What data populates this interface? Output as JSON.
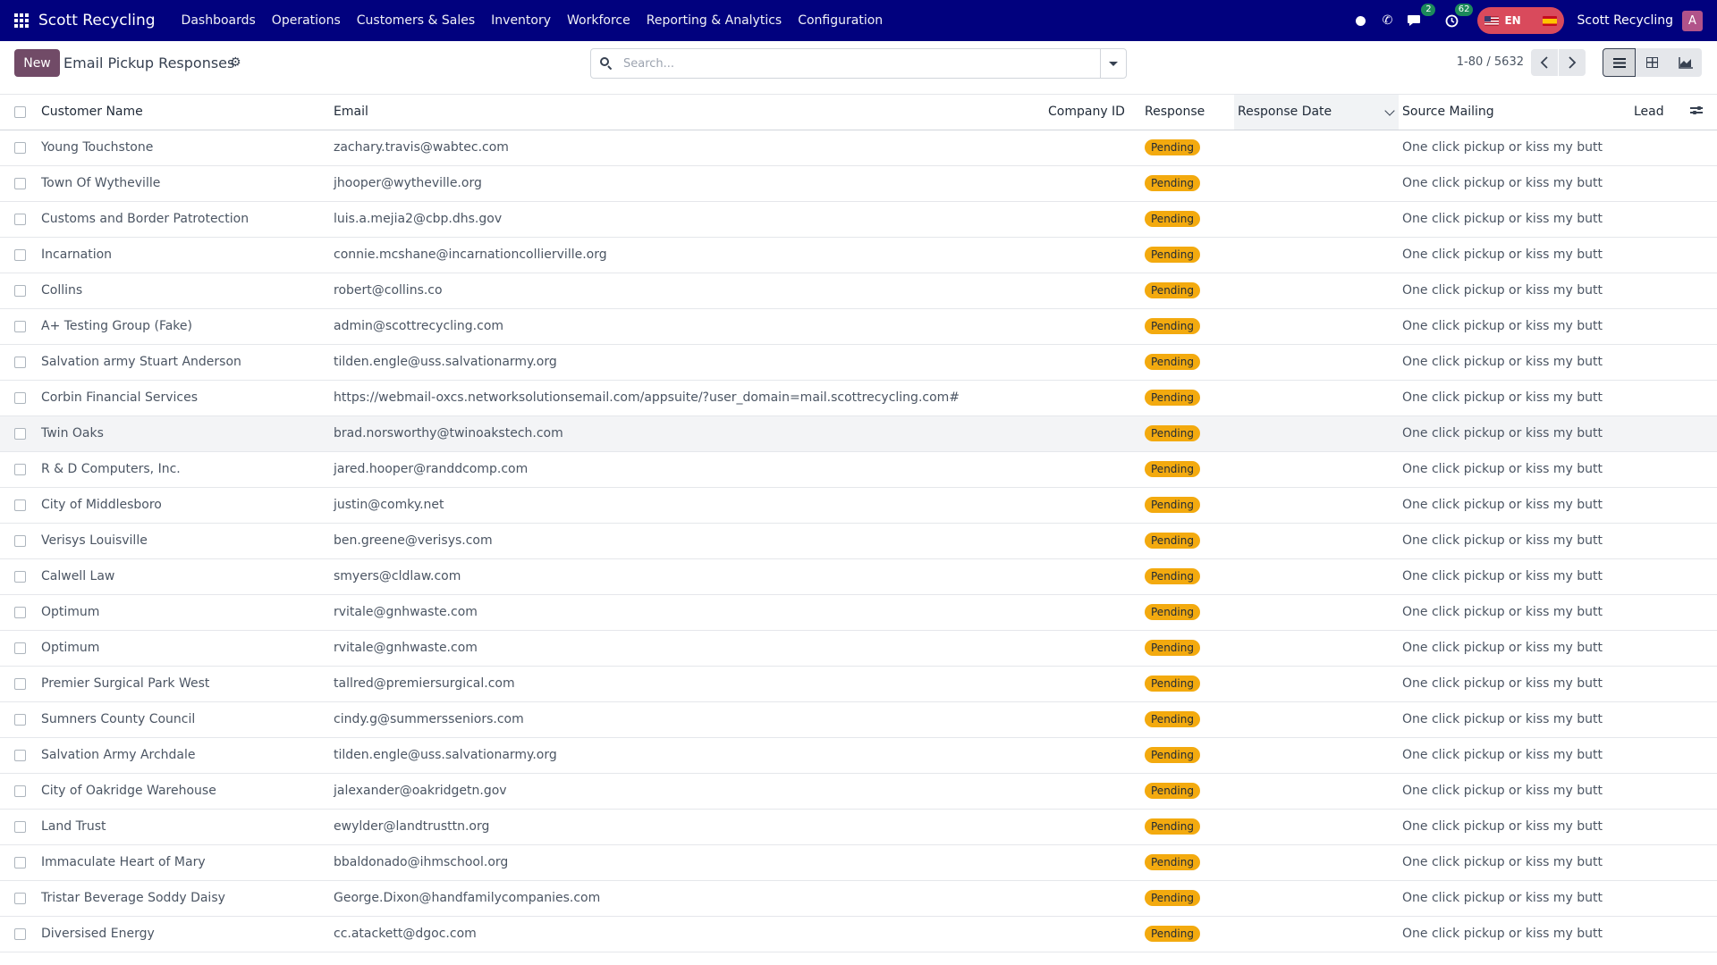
{
  "navbar": {
    "brand": "Scott Recycling",
    "menu": [
      "Dashboards",
      "Operations",
      "Customers & Sales",
      "Inventory",
      "Workforce",
      "Reporting & Analytics",
      "Configuration"
    ],
    "messages_badge": "2",
    "activities_badge": "62",
    "language": "EN",
    "company": "Scott Recycling",
    "avatar_letter": "A",
    "icons": [
      "apps-grid-icon",
      "status-dot-icon",
      "phone-icon",
      "chat-icon",
      "clock-icon",
      "flag-us-icon",
      "flag-es-icon"
    ]
  },
  "control": {
    "new_label": "New",
    "title": "Email Pickup Responses",
    "search_placeholder": "Search...",
    "pager": "1-80 / 5632"
  },
  "table": {
    "columns": {
      "customer": "Customer Name",
      "email": "Email",
      "company": "Company ID",
      "response": "Response",
      "date": "Response Date",
      "source": "Source Mailing",
      "lead": "Lead"
    },
    "rows": [
      {
        "customer": "Young Touchstone",
        "email": "zachary.travis@wabtec.com",
        "company": "",
        "response": "Pending",
        "date": "",
        "source": "One click pickup or kiss my butt",
        "lead": ""
      },
      {
        "customer": "Town Of Wytheville",
        "email": "jhooper@wytheville.org",
        "company": "",
        "response": "Pending",
        "date": "",
        "source": "One click pickup or kiss my butt",
        "lead": ""
      },
      {
        "customer": "Customs and Border Patrotection",
        "email": "luis.a.mejia2@cbp.dhs.gov",
        "company": "",
        "response": "Pending",
        "date": "",
        "source": "One click pickup or kiss my butt",
        "lead": ""
      },
      {
        "customer": "Incarnation",
        "email": "connie.mcshane@incarnationcollierville.org",
        "company": "",
        "response": "Pending",
        "date": "",
        "source": "One click pickup or kiss my butt",
        "lead": ""
      },
      {
        "customer": "Collins",
        "email": "robert@collins.co",
        "company": "",
        "response": "Pending",
        "date": "",
        "source": "One click pickup or kiss my butt",
        "lead": ""
      },
      {
        "customer": "A+ Testing Group (Fake)",
        "email": "admin@scottrecycling.com",
        "company": "",
        "response": "Pending",
        "date": "",
        "source": "One click pickup or kiss my butt",
        "lead": ""
      },
      {
        "customer": "Salvation army Stuart Anderson",
        "email": "tilden.engle@uss.salvationarmy.org",
        "company": "",
        "response": "Pending",
        "date": "",
        "source": "One click pickup or kiss my butt",
        "lead": ""
      },
      {
        "customer": "Corbin Financial Services",
        "email": "https://webmail-oxcs.networksolutionsemail.com/appsuite/?user_domain=mail.scottrecycling.com#",
        "company": "",
        "response": "Pending",
        "date": "",
        "source": "One click pickup or kiss my butt",
        "lead": ""
      },
      {
        "customer": "Twin Oaks",
        "email": "brad.norsworthy@twinoakstech.com",
        "company": "",
        "response": "Pending",
        "date": "",
        "source": "One click pickup or kiss my butt",
        "lead": ""
      },
      {
        "customer": "R & D Computers, Inc.",
        "email": "jared.hooper@randdcomp.com",
        "company": "",
        "response": "Pending",
        "date": "",
        "source": "One click pickup or kiss my butt",
        "lead": ""
      },
      {
        "customer": "City of Middlesboro",
        "email": "justin@comky.net",
        "company": "",
        "response": "Pending",
        "date": "",
        "source": "One click pickup or kiss my butt",
        "lead": ""
      },
      {
        "customer": "Verisys Louisville",
        "email": "ben.greene@verisys.com",
        "company": "",
        "response": "Pending",
        "date": "",
        "source": "One click pickup or kiss my butt",
        "lead": ""
      },
      {
        "customer": "Calwell Law",
        "email": "smyers@cldlaw.com",
        "company": "",
        "response": "Pending",
        "date": "",
        "source": "One click pickup or kiss my butt",
        "lead": ""
      },
      {
        "customer": "Optimum",
        "email": "rvitale@gnhwaste.com",
        "company": "",
        "response": "Pending",
        "date": "",
        "source": "One click pickup or kiss my butt",
        "lead": ""
      },
      {
        "customer": "Optimum",
        "email": "rvitale@gnhwaste.com",
        "company": "",
        "response": "Pending",
        "date": "",
        "source": "One click pickup or kiss my butt",
        "lead": ""
      },
      {
        "customer": "Premier Surgical Park West",
        "email": "tallred@premiersurgical.com",
        "company": "",
        "response": "Pending",
        "date": "",
        "source": "One click pickup or kiss my butt",
        "lead": ""
      },
      {
        "customer": "Sumners County Council",
        "email": "cindy.g@summersseniors.com",
        "company": "",
        "response": "Pending",
        "date": "",
        "source": "One click pickup or kiss my butt",
        "lead": ""
      },
      {
        "customer": "Salvation Army Archdale",
        "email": "tilden.engle@uss.salvationarmy.org",
        "company": "",
        "response": "Pending",
        "date": "",
        "source": "One click pickup or kiss my butt",
        "lead": ""
      },
      {
        "customer": "City of Oakridge Warehouse",
        "email": "jalexander@oakridgetn.gov",
        "company": "",
        "response": "Pending",
        "date": "",
        "source": "One click pickup or kiss my butt",
        "lead": ""
      },
      {
        "customer": "Land Trust",
        "email": "ewylder@landtrusttn.org",
        "company": "",
        "response": "Pending",
        "date": "",
        "source": "One click pickup or kiss my butt",
        "lead": ""
      },
      {
        "customer": "Immaculate Heart of Mary",
        "email": "bbaldonado@ihmschool.org",
        "company": "",
        "response": "Pending",
        "date": "",
        "source": "One click pickup or kiss my butt",
        "lead": ""
      },
      {
        "customer": "Tristar Beverage Soddy Daisy",
        "email": "George.Dixon@handfamilycompanies.com",
        "company": "",
        "response": "Pending",
        "date": "",
        "source": "One click pickup or kiss my butt",
        "lead": ""
      },
      {
        "customer": "Diversised Energy",
        "email": "cc.atackett@dgoc.com",
        "company": "",
        "response": "Pending",
        "date": "",
        "source": "One click pickup or kiss my butt",
        "lead": ""
      }
    ]
  }
}
